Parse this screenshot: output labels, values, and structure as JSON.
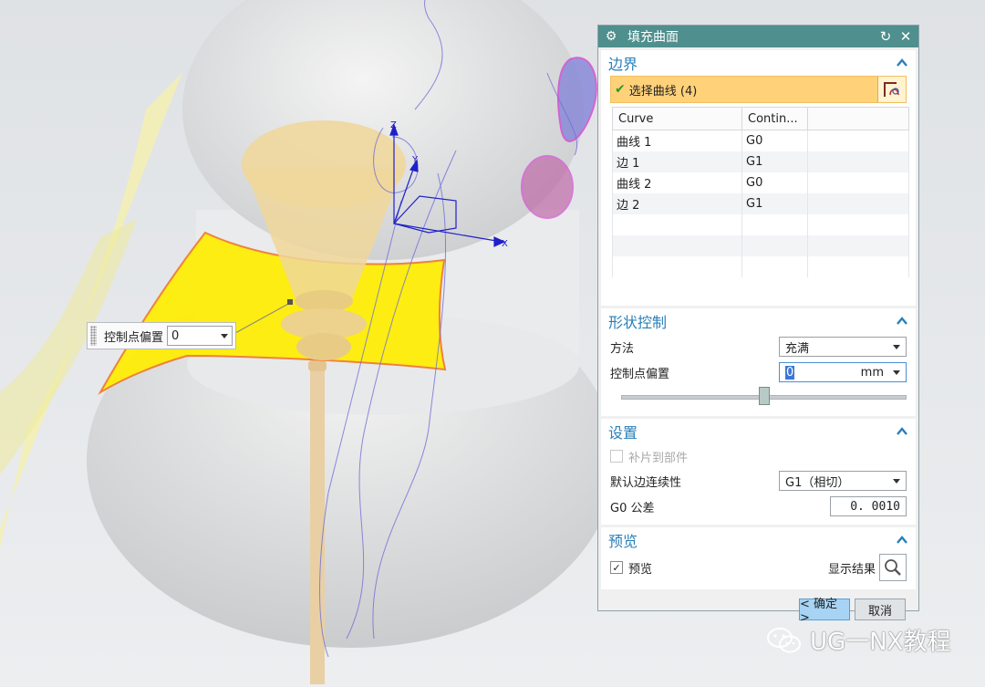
{
  "viewport": {
    "axes": {
      "x": "X",
      "y": "Y",
      "z": "Z"
    }
  },
  "floating_control": {
    "label": "控制点偏置",
    "value": "0"
  },
  "dialog": {
    "title": "填充曲面",
    "boundary": {
      "title": "边界",
      "select_label": "选择曲线 (4)",
      "columns": [
        "Curve",
        "Contin..."
      ],
      "rows": [
        {
          "name": "曲线 1",
          "cont": "G0"
        },
        {
          "name": "边 1",
          "cont": "G1"
        },
        {
          "name": "曲线 2",
          "cont": "G0"
        },
        {
          "name": "边 2",
          "cont": "G1"
        }
      ]
    },
    "shape": {
      "title": "形状控制",
      "method_label": "方法",
      "method_value": "充满",
      "offset_label": "控制点偏置",
      "offset_value": "0",
      "offset_unit": "mm",
      "slider_fraction": 0.5
    },
    "settings": {
      "title": "设置",
      "patch_label": "补片到部件",
      "continuity_label": "默认边连续性",
      "continuity_value": "G1（相切）",
      "g0_label": "G0 公差",
      "g0_value": "0. 0010"
    },
    "preview": {
      "title": "预览",
      "preview_label": "预览",
      "show_result_label": "显示结果"
    },
    "ok_label": "< 确定 >",
    "cancel_label": "取消"
  },
  "watermark": "UG一NX教程",
  "colors": {
    "title_bar": "#4f8f8d",
    "group_title": "#2a7fb8",
    "selection_bg": "#ffd27a",
    "surface_yellow": "#ffee00",
    "primary_button": "#a7d4f5"
  }
}
